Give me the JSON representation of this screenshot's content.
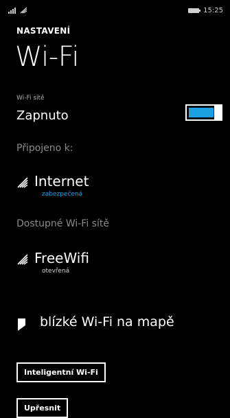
{
  "status_bar": {
    "time": "15:25",
    "icons": [
      "signal-icon",
      "wifi-status-icon",
      "battery-icon"
    ]
  },
  "header": {
    "app_name": "NASTAVENÍ",
    "page_title": "Wi-Fi"
  },
  "wifi_toggle": {
    "label": "Wi-Fi sítě",
    "value": "Zapnuto",
    "state": "on",
    "accent_color": "#1ba1e2"
  },
  "connected": {
    "section_label": "Připojeno k:",
    "network": {
      "name": "Internet",
      "status": "zabezpečená",
      "status_color": "#1ba1e2",
      "icon": "wifi-icon"
    }
  },
  "available": {
    "section_label": "Dostupné Wi-Fi sítě",
    "networks": [
      {
        "name": "FreeWifi",
        "status": "otevřená",
        "status_color": "#cfcfcf",
        "icon": "wifi-icon"
      }
    ]
  },
  "map_link": {
    "label": "blízké Wi-Fi na mapě",
    "icon": "map-pin-icon"
  },
  "buttons": {
    "smart_wifi": "Inteligentní Wi-Fi",
    "advanced": "Upřesnit"
  },
  "colors": {
    "background": "#000000",
    "foreground": "#ffffff",
    "accent": "#1ba1e2",
    "muted": "#8a8a8a"
  }
}
